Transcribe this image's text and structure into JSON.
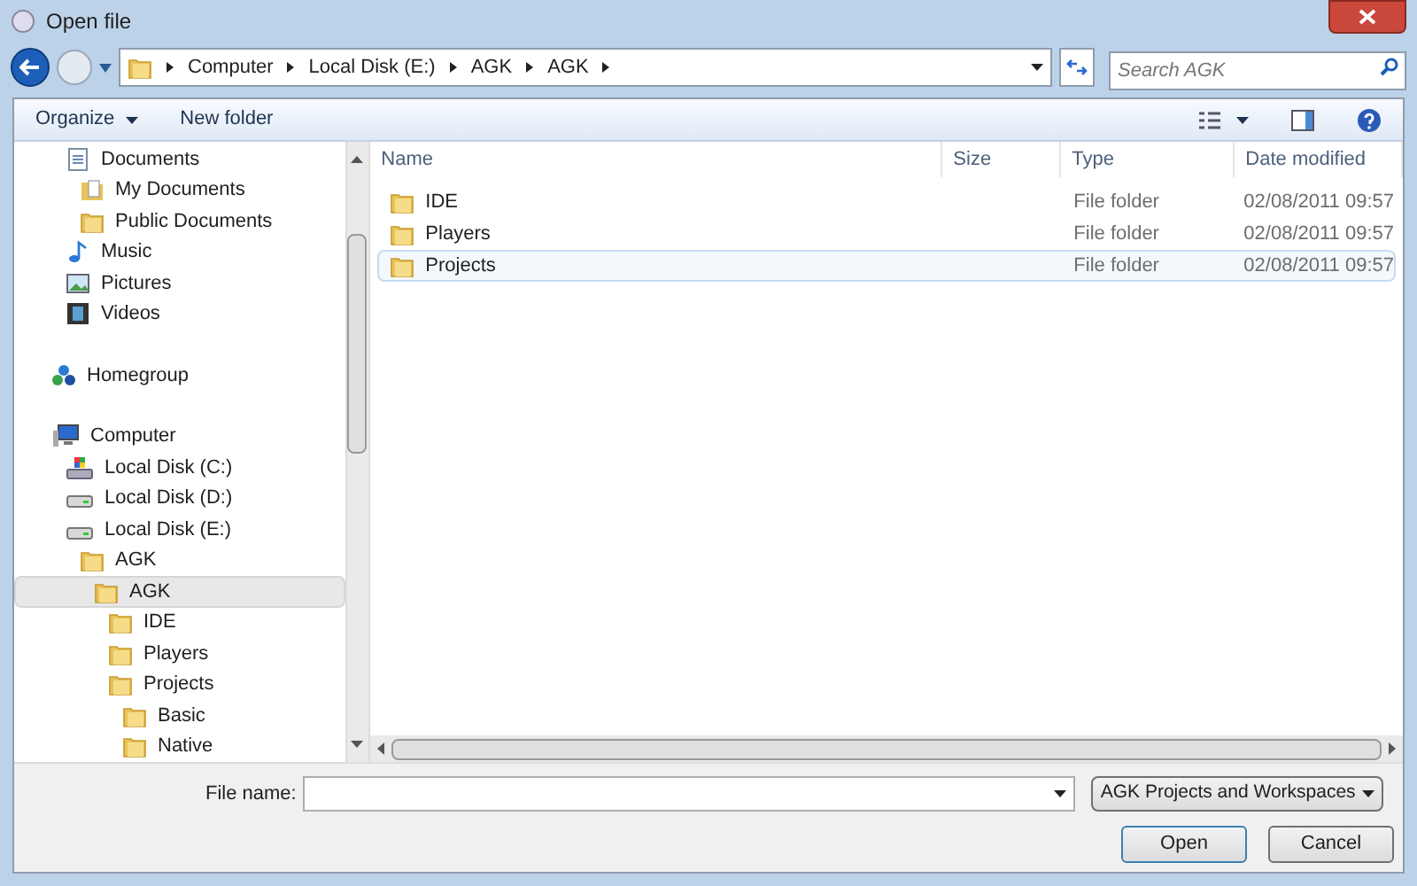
{
  "window": {
    "title": "Open file"
  },
  "address": {
    "crumbs": [
      "Computer",
      "Local Disk (E:)",
      "AGK",
      "AGK"
    ]
  },
  "search": {
    "placeholder": "Search AGK"
  },
  "toolbar": {
    "buttons": [
      "Organize",
      "New folder"
    ]
  },
  "nav": {
    "sections": [
      {
        "items": [
          {
            "label": "Documents",
            "kind": "library",
            "selected": false,
            "children": [
              {
                "label": "My Documents",
                "kind": "docfolder",
                "selected": false
              },
              {
                "label": "Public Documents",
                "kind": "folder",
                "selected": false
              }
            ]
          },
          {
            "label": "Music",
            "kind": "music",
            "selected": false
          },
          {
            "label": "Pictures",
            "kind": "pictures",
            "selected": false
          },
          {
            "label": "Videos",
            "kind": "videos",
            "selected": false
          }
        ]
      },
      {
        "items": [
          {
            "label": "Homegroup",
            "kind": "homegroup",
            "selected": false
          }
        ]
      },
      {
        "items": [
          {
            "label": "Computer",
            "kind": "computer",
            "selected": false,
            "children": [
              {
                "label": "Local Disk (C:)",
                "kind": "sysdisk",
                "selected": false
              },
              {
                "label": "Local Disk (D:)",
                "kind": "disk",
                "selected": false
              },
              {
                "label": "Local Disk (E:)",
                "kind": "disk",
                "selected": false,
                "children": [
                  {
                    "label": "AGK",
                    "kind": "folder",
                    "selected": false,
                    "children": [
                      {
                        "label": "AGK",
                        "kind": "folder",
                        "selected": true,
                        "children": [
                          {
                            "label": "IDE",
                            "kind": "folder",
                            "selected": false
                          },
                          {
                            "label": "Players",
                            "kind": "folder",
                            "selected": false
                          },
                          {
                            "label": "Projects",
                            "kind": "folder",
                            "selected": false,
                            "children": [
                              {
                                "label": "Basic",
                                "kind": "folder",
                                "selected": false
                              },
                              {
                                "label": "Native",
                                "kind": "folder",
                                "selected": false
                              }
                            ]
                          }
                        ]
                      }
                    ]
                  }
                ]
              }
            ]
          }
        ]
      }
    ]
  },
  "columns": [
    "Name",
    "Size",
    "Type",
    "Date modified"
  ],
  "rows": [
    {
      "name": "IDE",
      "type": "File folder",
      "date": "02/08/2011 09:57",
      "selected": false
    },
    {
      "name": "Players",
      "type": "File folder",
      "date": "02/08/2011 09:57",
      "selected": false
    },
    {
      "name": "Projects",
      "type": "File folder",
      "date": "02/08/2011 09:57",
      "selected": true
    }
  ],
  "file_name": {
    "label": "File name:"
  },
  "filter": {
    "value": "AGK Projects and Workspaces"
  },
  "buttons": [
    "Open",
    "Cancel"
  ]
}
